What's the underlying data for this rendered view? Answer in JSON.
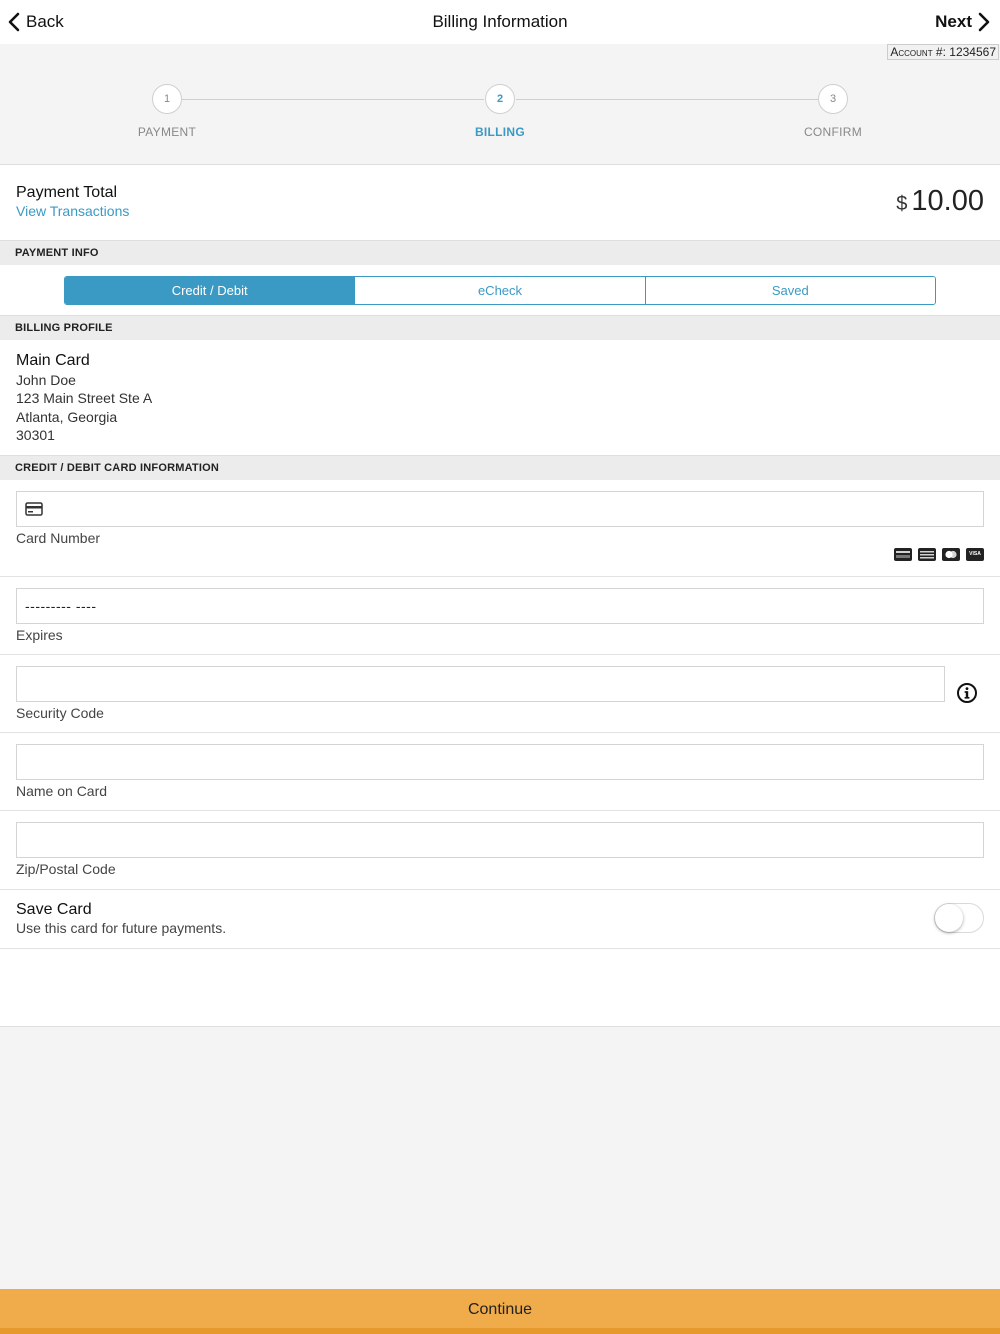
{
  "nav": {
    "back_label": "Back",
    "title": "Billing Information",
    "next_label": "Next"
  },
  "account": {
    "label": "Account #:",
    "number": "1234567"
  },
  "stepper": {
    "steps": [
      {
        "number": "1",
        "label": "PAYMENT"
      },
      {
        "number": "2",
        "label": "BILLING"
      },
      {
        "number": "3",
        "label": "CONFIRM"
      }
    ],
    "active_step": "2"
  },
  "payment_total": {
    "title": "Payment Total",
    "link": "View Transactions",
    "currency": "$",
    "amount": "10.00"
  },
  "payment_info": {
    "header": "PAYMENT INFO",
    "tabs": [
      {
        "label": "Credit / Debit"
      },
      {
        "label": "eCheck"
      },
      {
        "label": "Saved"
      }
    ],
    "selected_tab": "Credit / Debit"
  },
  "billing_profile": {
    "header": "BILLING PROFILE",
    "name": "Main Card",
    "lines": [
      "John Doe",
      "123 Main Street Ste A",
      "Atlanta, Georgia",
      "30301"
    ]
  },
  "card_info": {
    "header": "CREDIT / DEBIT CARD INFORMATION",
    "card_number": {
      "label": "Card Number",
      "value": ""
    },
    "expires": {
      "label": "Expires",
      "value": "--------- ----"
    },
    "security_code": {
      "label": "Security Code",
      "value": ""
    },
    "name_on_card": {
      "label": "Name on Card",
      "value": ""
    },
    "zip": {
      "label": "Zip/Postal Code",
      "value": ""
    },
    "card_brands": [
      "discover-icon",
      "amex-icon",
      "mastercard-icon",
      "visa-icon"
    ],
    "visa_text": "VISA"
  },
  "save_card": {
    "title": "Save Card",
    "description": "Use this card for future payments.",
    "enabled": false
  },
  "continue_label": "Continue",
  "colors": {
    "accent": "#3a9ac4",
    "continue_bg": "#f0ab4a",
    "section_bg": "#ececec"
  }
}
